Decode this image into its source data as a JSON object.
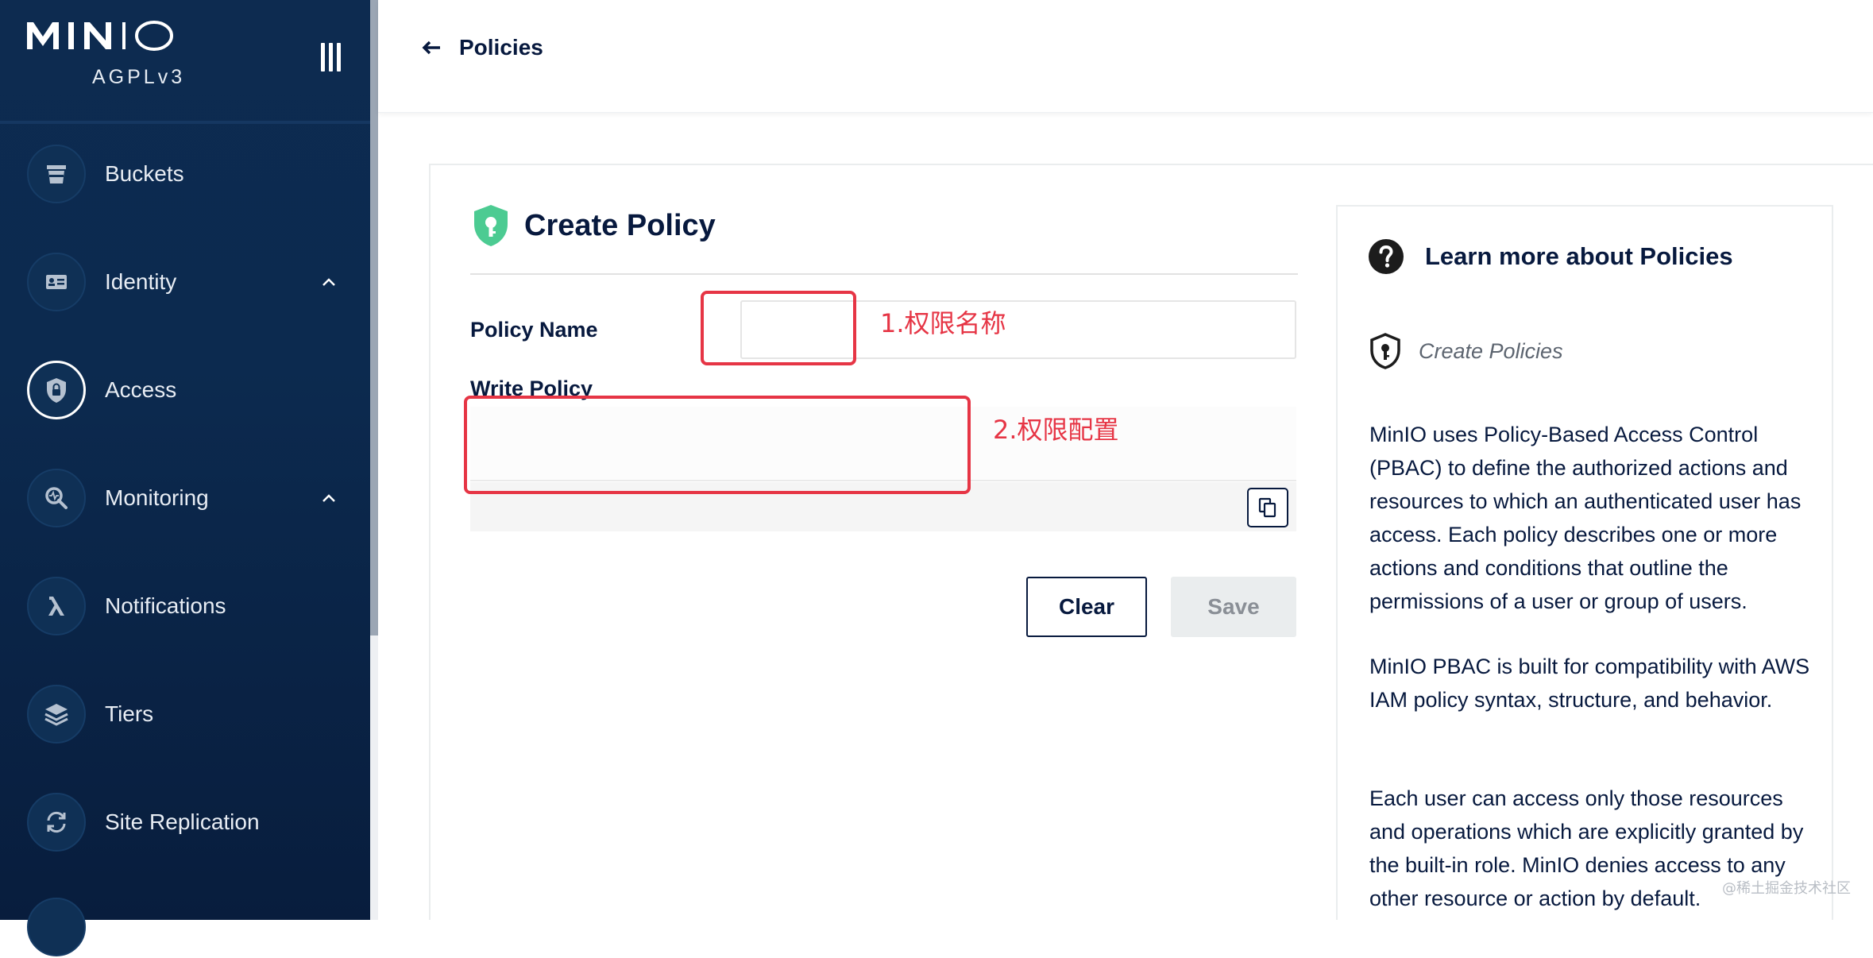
{
  "sidebar": {
    "brand": "MINIO",
    "license": "AGPLv3",
    "items": [
      {
        "label": "Buckets",
        "icon": "bucket-icon",
        "expandable": false
      },
      {
        "label": "Identity",
        "icon": "id-card-icon",
        "expandable": true
      },
      {
        "label": "Access",
        "icon": "shield-lock-icon",
        "expandable": false,
        "active": true
      },
      {
        "label": "Monitoring",
        "icon": "monitoring-icon",
        "expandable": true
      },
      {
        "label": "Notifications",
        "icon": "lambda-icon",
        "expandable": false
      },
      {
        "label": "Tiers",
        "icon": "layers-icon",
        "expandable": false
      },
      {
        "label": "Site Replication",
        "icon": "replication-icon",
        "expandable": false
      }
    ]
  },
  "header": {
    "back_label": "Policies"
  },
  "form": {
    "title": "Create Policy",
    "policy_name_label": "Policy Name",
    "policy_name_value": "",
    "write_policy_label": "Write Policy",
    "clear_label": "Clear",
    "save_label": "Save"
  },
  "annotations": {
    "name_note": "1.权限名称",
    "config_note": "2.权限配置"
  },
  "help": {
    "title": "Learn more about Policies",
    "subtitle": "Create Policies",
    "para1": "MinIO uses Policy-Based Access Control (PBAC) to define the authorized actions and resources to which an authenticated user has access. Each policy describes one or more actions and conditions that outline the permissions of a user or group of users.",
    "para2": "MinIO PBAC is built for compatibility with AWS IAM policy syntax, structure, and behavior.",
    "para3": "Each user can access only those resources and operations which are explicitly granted by the built-in role. MinIO denies access to any other resource or action by default."
  },
  "watermark": "@稀土掘金技术社区",
  "colors": {
    "sidebar_bg": "#0c2a4f",
    "primary_text": "#07193e",
    "accent_green": "#4ccb92",
    "annotation_red": "#e63545",
    "save_disabled_bg": "#eaedee"
  }
}
